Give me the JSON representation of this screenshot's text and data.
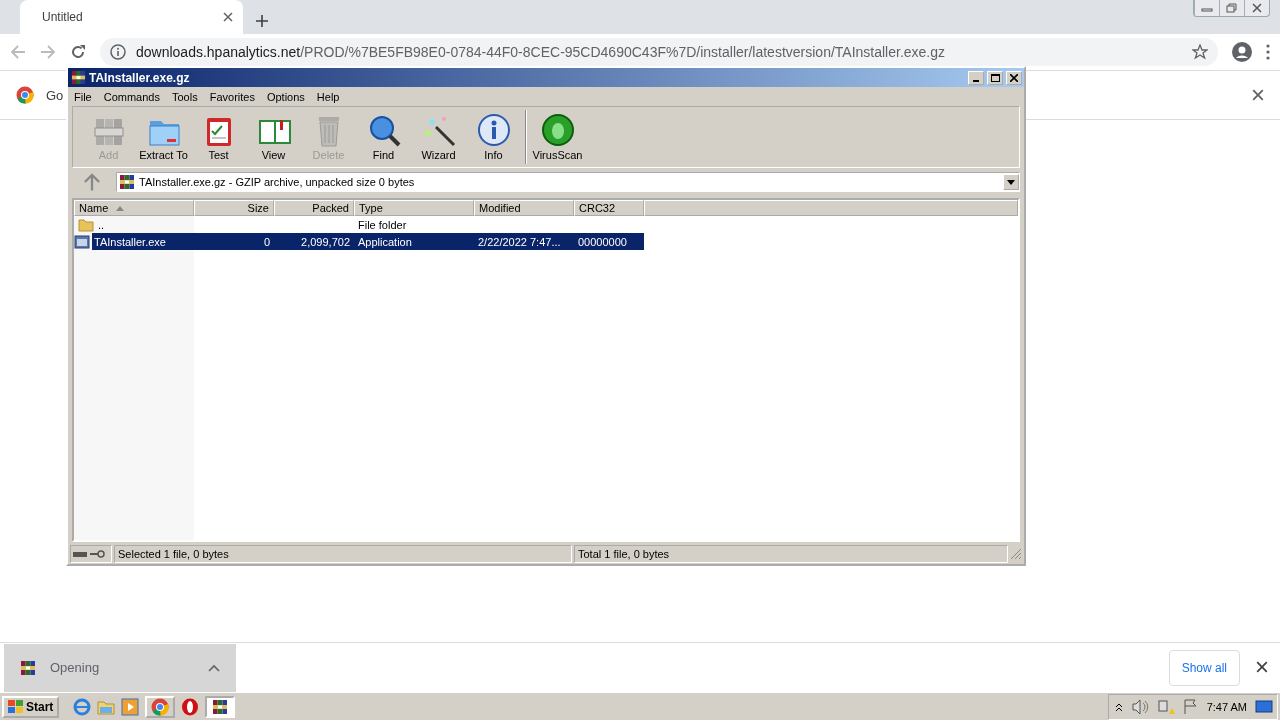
{
  "browser": {
    "tabs": [
      {
        "title": "Untitled",
        "selected": true
      }
    ],
    "address": {
      "host": "downloads.hpanalytics.net",
      "path": "/PROD/%7BE5FB98E0-0784-44F0-8CEC-95CD4690C43F%7D/installer/latestversion/TAInstaller.exe.gz"
    },
    "infobar": {
      "text": "Go"
    }
  },
  "archiver": {
    "title": "TAInstaller.exe.gz",
    "menu": [
      "File",
      "Commands",
      "Tools",
      "Favorites",
      "Options",
      "Help"
    ],
    "toolbar_groups": [
      [
        {
          "label": "Add",
          "disabled": true
        },
        {
          "label": "Extract To",
          "disabled": false
        },
        {
          "label": "Test",
          "disabled": false
        },
        {
          "label": "View",
          "disabled": false
        },
        {
          "label": "Delete",
          "disabled": true
        },
        {
          "label": "Find",
          "disabled": false
        },
        {
          "label": "Wizard",
          "disabled": false
        },
        {
          "label": "Info",
          "disabled": false
        }
      ],
      [
        {
          "label": "VirusScan",
          "disabled": false
        }
      ]
    ],
    "path": "TAInstaller.exe.gz - GZIP archive, unpacked size 0 bytes",
    "columns": [
      {
        "label": "Name",
        "sorted": true
      },
      {
        "label": "Size",
        "sorted": false
      },
      {
        "label": "Packed",
        "sorted": false
      },
      {
        "label": "Type",
        "sorted": false
      },
      {
        "label": "Modified",
        "sorted": false
      },
      {
        "label": "CRC32",
        "sorted": false
      }
    ],
    "rows": [
      {
        "kind": "folder",
        "selected": false,
        "cells": [
          "..",
          "",
          "",
          "File folder",
          "",
          ""
        ]
      },
      {
        "kind": "file",
        "selected": true,
        "cells": [
          "TAInstaller.exe",
          "0",
          "2,099,702",
          "Application",
          "2/22/2022 7:47...",
          "00000000"
        ]
      }
    ],
    "status": [
      "Selected 1 file, 0 bytes",
      "Total 1 file, 0 bytes"
    ]
  },
  "downloads": {
    "items": [
      {
        "label": "Opening"
      }
    ],
    "show_all": "Show all"
  },
  "taskbar": {
    "start": "Start",
    "tasks": [
      {
        "selected": false
      },
      {
        "selected": true
      }
    ],
    "clock": "7:47 AM"
  }
}
